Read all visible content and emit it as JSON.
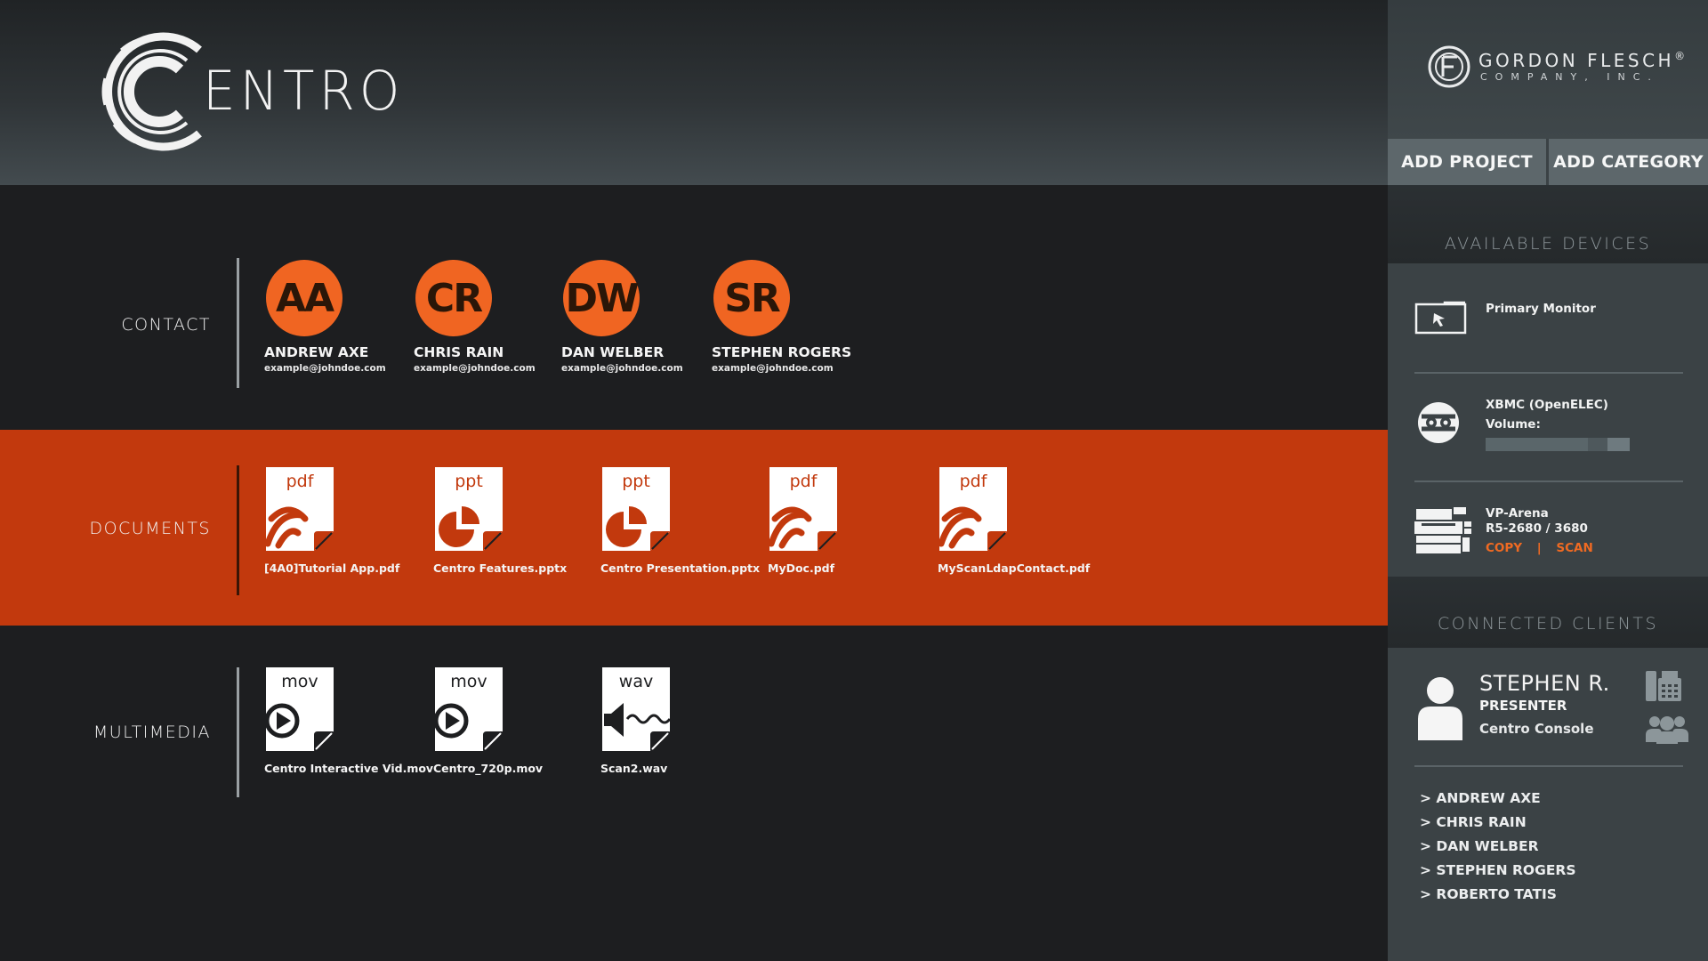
{
  "app": {
    "logo_text": "ENTRO"
  },
  "brand": {
    "name": "GORDON FLESCH",
    "reg": "®",
    "subtitle": "COMPANY, INC."
  },
  "toolbar": {
    "add_project": "ADD PROJECT",
    "add_category": "ADD CATEGORY"
  },
  "colors": {
    "accent": "#f06522",
    "documents_band": "#c2390d",
    "sidebar": "#3b4245",
    "background": "#1d1e20"
  },
  "contacts": {
    "label": "CONTACT",
    "items": [
      {
        "initials": "AA",
        "name": "ANDREW AXE",
        "email": "example@johndoe.com"
      },
      {
        "initials": "CR",
        "name": "CHRIS RAIN",
        "email": "example@johndoe.com"
      },
      {
        "initials": "DW",
        "name": "DAN WELBER",
        "email": "example@johndoe.com"
      },
      {
        "initials": "SR",
        "name": "STEPHEN ROGERS",
        "email": "example@johndoe.com"
      }
    ]
  },
  "documents": {
    "label": "DOCUMENTS",
    "items": [
      {
        "type": "pdf",
        "icon": "pdf-file-icon",
        "name": "[4A0]Tutorial App.pdf"
      },
      {
        "type": "ppt",
        "icon": "ppt-file-icon",
        "name": "Centro Features.pptx"
      },
      {
        "type": "ppt",
        "icon": "ppt-file-icon",
        "name": "Centro Presentation.pptx"
      },
      {
        "type": "pdf",
        "icon": "pdf-file-icon",
        "name": "MyDoc.pdf"
      },
      {
        "type": "pdf",
        "icon": "pdf-file-icon",
        "name": "MyScanLdapContact.pdf"
      }
    ]
  },
  "multimedia": {
    "label": "MULTIMEDIA",
    "items": [
      {
        "type": "mov",
        "icon": "video-file-icon",
        "name": "Centro Interactive Vid.mov"
      },
      {
        "type": "mov",
        "icon": "video-file-icon",
        "name": "Centro_720p.mov"
      },
      {
        "type": "wav",
        "icon": "audio-file-icon",
        "name": "Scan2.wav"
      }
    ]
  },
  "devices": {
    "title": "AVAILABLE DEVICES",
    "primary_monitor": {
      "label": "Primary Monitor",
      "icon": "monitor-icon"
    },
    "xbmc": {
      "label": "XBMC (OpenELEC)",
      "volume_label": "Volume:",
      "volume_level": 0.78,
      "icon": "xbmc-icon"
    },
    "printer": {
      "name": "VP-Arena",
      "model": "R5-2680 / 3680",
      "copy": "COPY",
      "separator": "|",
      "scan": "SCAN",
      "icon": "printer-icon"
    }
  },
  "clients": {
    "title": "CONNECTED CLIENTS",
    "presenter": {
      "name": "STEPHEN R.",
      "role": "PRESENTER",
      "console": "Centro Console"
    },
    "list": [
      "> ANDREW AXE",
      "> CHRIS RAIN",
      "> DAN WELBER",
      "> STEPHEN ROGERS",
      "> ROBERTO TATIS"
    ]
  }
}
